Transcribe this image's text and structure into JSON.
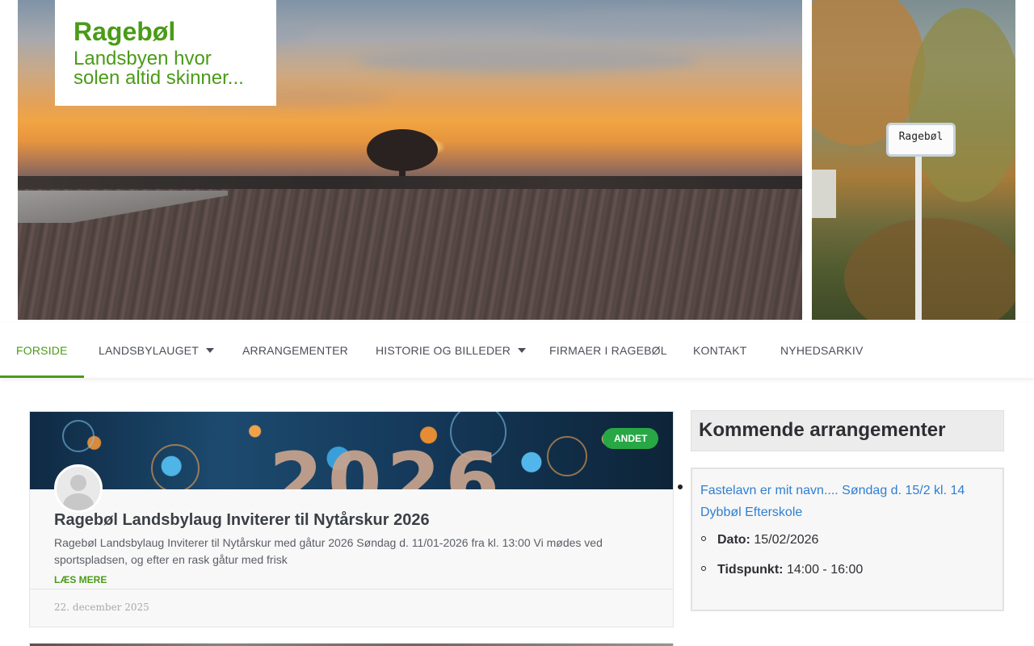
{
  "site": {
    "title": "Ragebøl",
    "tagline": "Landsbyen hvor solen altid skinner..."
  },
  "hero": {
    "sign_text": "Ragebøl"
  },
  "nav": {
    "items": [
      {
        "label": "FORSIDE",
        "active": true,
        "dropdown": false
      },
      {
        "label": "LANDSBYLAUGET",
        "active": false,
        "dropdown": true
      },
      {
        "label": "ARRANGEMENTER",
        "active": false,
        "dropdown": false
      },
      {
        "label": "HISTORIE OG BILLEDER",
        "active": false,
        "dropdown": true
      },
      {
        "label": "FIRMAER I RAGEBØL",
        "active": false,
        "dropdown": false
      },
      {
        "label": "KONTAKT",
        "active": false,
        "dropdown": false
      },
      {
        "label": "NYHEDSARKIV",
        "active": false,
        "dropdown": false
      }
    ]
  },
  "post": {
    "category": "ANDET",
    "image_text": "2026",
    "title": "Ragebøl Landsbylaug Inviterer til Nytårskur 2026",
    "excerpt": "Ragebøl Landsbylaug Inviterer til Nytårskur med gåtur 2026 Søndag d. 11/01-2026 fra kl. 13:00 Vi mødes ved sportspladsen, og efter en rask gåtur med frisk",
    "read_more": "LÆS MERE",
    "date": "22. december 2025"
  },
  "sidebar": {
    "widget_title": "Kommende arrangementer",
    "event": {
      "title": "Fastelavn er mit navn.... Søndag d. 15/2 kl. 14 Dybbøl Efterskole",
      "date_label": "Dato:",
      "date_value": "15/02/2026",
      "time_label": "Tidspunkt:",
      "time_value": "14:00 - 16:00"
    }
  },
  "colors": {
    "brand_green": "#4a9b18",
    "badge_green": "#28a745",
    "link_blue": "#2f7fd1"
  }
}
